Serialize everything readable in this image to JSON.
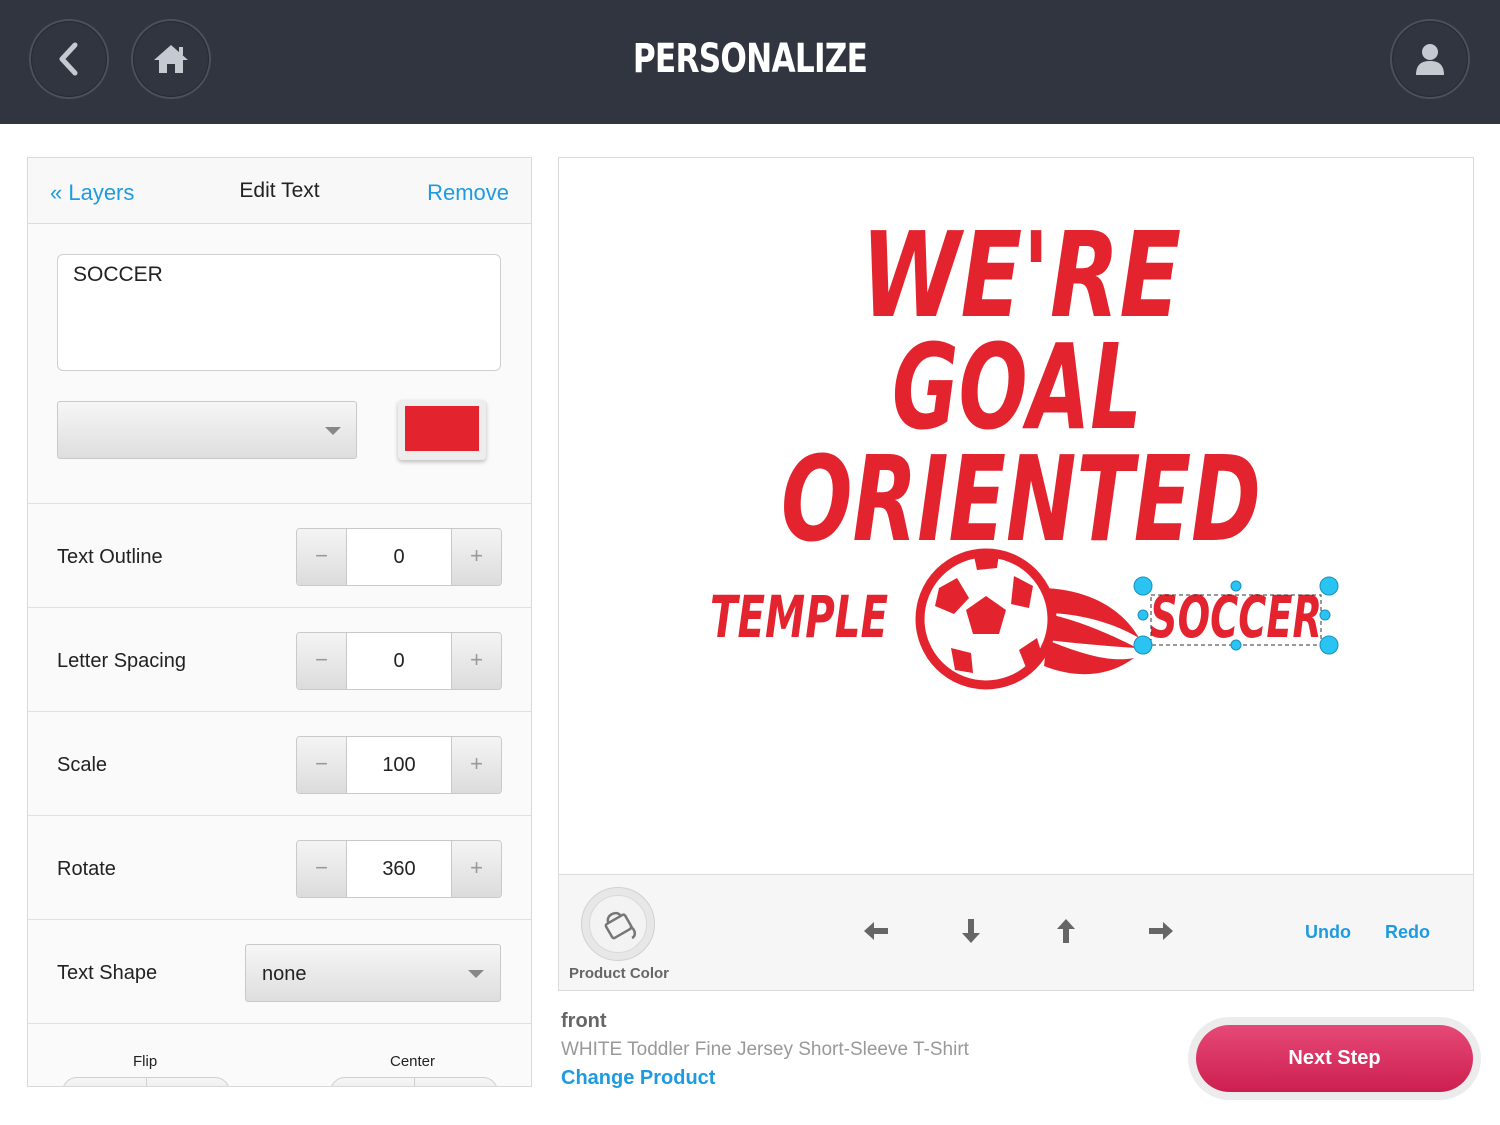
{
  "header": {
    "title": "PERSONALIZE",
    "back_icon": "chevron-left-icon",
    "home_icon": "home-icon",
    "user_icon": "user-icon"
  },
  "panel": {
    "layers_link": "« Layers",
    "title": "Edit Text",
    "remove_link": "Remove",
    "text_value": "SOCCER",
    "font_select_value": "",
    "text_color": "#e3242f",
    "rows": {
      "text_outline": {
        "label": "Text Outline",
        "value": "0"
      },
      "letter_spacing": {
        "label": "Letter Spacing",
        "value": "0"
      },
      "scale": {
        "label": "Scale",
        "value": "100"
      },
      "rotate": {
        "label": "Rotate",
        "value": "360"
      }
    },
    "stepper_minus": "−",
    "stepper_plus": "+",
    "text_shape": {
      "label": "Text Shape",
      "value": "none"
    },
    "flip_label": "Flip",
    "center_label": "Center"
  },
  "design": {
    "line1": "WE'RE",
    "line2": "GOAL",
    "line3": "ORIENTED",
    "left_word": "TEMPLE",
    "right_word": "SOCCER",
    "ink_color": "#e3242f",
    "selection_color": "#29c4f2"
  },
  "toolbar": {
    "product_color_label": "Product Color",
    "undo": "Undo",
    "redo": "Redo"
  },
  "product": {
    "side": "front",
    "name": "WHITE Toddler Fine Jersey Short-Sleeve T-Shirt",
    "change_link": "Change Product"
  },
  "next_button": "Next Step"
}
